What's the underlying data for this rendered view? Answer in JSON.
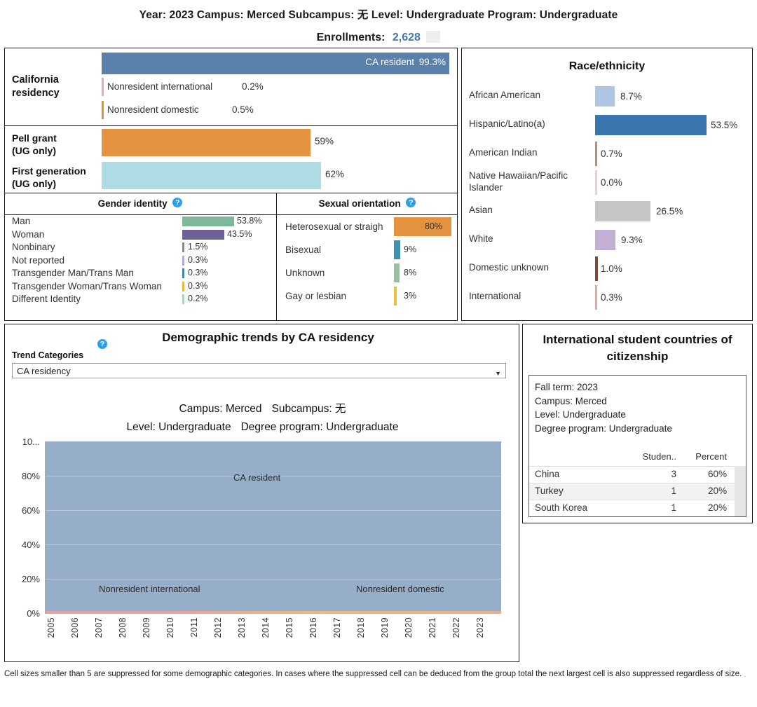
{
  "header": {
    "filters_line": "Year: 2023  Campus: Merced  Subcampus: 无  Level: Undergraduate  Program: Undergraduate",
    "enrollments_label": "Enrollments:",
    "enrollments_value": "2,628"
  },
  "residency": {
    "title": "California residency",
    "title_l1": "California",
    "title_l2": "residency",
    "items": [
      {
        "label": "CA resident",
        "value": "99.3%",
        "pct": 99.3,
        "color": "#5a81ac",
        "major": true
      },
      {
        "label": "Nonresident international",
        "value": "0.2%",
        "pct": 0.2,
        "color": "#eaa9aa",
        "major": false
      },
      {
        "label": "Nonresident domestic",
        "value": "0.5%",
        "pct": 0.5,
        "color": "#e8912f",
        "major": false
      }
    ]
  },
  "pell_firstgen": {
    "items": [
      {
        "label_l1": "Pell grant",
        "label_l2": "(UG only)",
        "value": "59%",
        "pct": 59,
        "color": "#e3933d"
      },
      {
        "label_l1": "First generation",
        "label_l2": "(UG only)",
        "value": "62%",
        "pct": 62,
        "color": "#aedce5"
      }
    ]
  },
  "gender_identity": {
    "title": "Gender identity",
    "help_icon": "help-circle-icon",
    "items": [
      {
        "label": "Man",
        "value": "53.8%",
        "pct": 53.8,
        "color": "#7db89a"
      },
      {
        "label": "Woman",
        "value": "43.5%",
        "pct": 43.5,
        "color": "#6d6196"
      },
      {
        "label": "Nonbinary",
        "value": "1.5%",
        "pct": 1.5,
        "color": "#8a8a8a"
      },
      {
        "label": "Not reported",
        "value": "0.3%",
        "pct": 0.3,
        "color": "#a8aedd"
      },
      {
        "label": "Transgender Man/Trans Man",
        "value": "0.3%",
        "pct": 0.3,
        "color": "#3f87a6"
      },
      {
        "label": "Transgender Woman/Trans Woman",
        "value": "0.3%",
        "pct": 0.3,
        "color": "#e8b63c"
      },
      {
        "label": "Different Identity",
        "value": "0.2%",
        "pct": 0.2,
        "color": "#a8d5b8"
      }
    ]
  },
  "sexual_orientation": {
    "title": "Sexual orientation",
    "help_icon": "help-circle-icon",
    "items": [
      {
        "label": "Heterosexual or straigh",
        "value": "80%",
        "pct": 80,
        "color": "#e3933d"
      },
      {
        "label": "Bisexual",
        "value": "9%",
        "pct": 9,
        "color": "#4190ac"
      },
      {
        "label": "Unknown",
        "value": "8%",
        "pct": 8,
        "color": "#9cbfa4"
      },
      {
        "label": "Gay or lesbian",
        "value": "3%",
        "pct": 3,
        "color": "#ecc33f"
      }
    ]
  },
  "race_ethnicity": {
    "title": "Race/ethnicity",
    "items": [
      {
        "label": "African American",
        "value": "8.7%",
        "pct": 8.7,
        "color": "#aec6e4",
        "wrap": false
      },
      {
        "label": "Hispanic/Latino(a)",
        "value": "53.5%",
        "pct": 53.5,
        "color": "#3a76ad",
        "wrap": false
      },
      {
        "label": "American Indian",
        "value": "0.7%",
        "pct": 0.7,
        "color": "#c08a7a",
        "wrap": false
      },
      {
        "label": "Native Hawaiian/Pacific Islander",
        "value": "0.0%",
        "pct": 0.0,
        "color": "#f3cdcd",
        "wrap": true
      },
      {
        "label": "Asian",
        "value": "26.5%",
        "pct": 26.5,
        "color": "#c6c6c6",
        "wrap": false
      },
      {
        "label": "White",
        "value": "9.3%",
        "pct": 9.3,
        "color": "#c3aed4",
        "wrap": false
      },
      {
        "label": "Domestic unknown",
        "value": "1.0%",
        "pct": 1.0,
        "color": "#7a4b3a",
        "wrap": false
      },
      {
        "label": "International",
        "value": "0.3%",
        "pct": 0.3,
        "color": "#e8a8a0",
        "wrap": false
      }
    ]
  },
  "trends": {
    "title": "Demographic trends by CA residency",
    "help_icon": "help-circle-icon",
    "trend_categories_label": "Trend Categories",
    "selected_category": "CA residency",
    "dropdown_options": [
      "CA residency"
    ],
    "dropdown_arrow": "chevron-down-icon",
    "subtitle_line1_a": "Campus: Merced",
    "subtitle_line1_b": "Subcampus: 无",
    "subtitle_line2_a": "Level: Undergraduate",
    "subtitle_line2_b": "Degree program: Undergraduate"
  },
  "chart_data": {
    "type": "area",
    "title": "Demographic trends by CA residency",
    "xlabel": "",
    "ylabel": "",
    "ylim": [
      0,
      100
    ],
    "grid": true,
    "ytick_labels": [
      "10...",
      "80%",
      "60%",
      "40%",
      "20%",
      "0%"
    ],
    "ytick_values": [
      100,
      80,
      60,
      40,
      20,
      0
    ],
    "x": [
      2005,
      2006,
      2007,
      2008,
      2009,
      2010,
      2011,
      2012,
      2013,
      2014,
      2015,
      2016,
      2017,
      2018,
      2019,
      2020,
      2021,
      2022,
      2023
    ],
    "annotations": [
      {
        "text": "CA resident",
        "x": 2013,
        "y": 50
      },
      {
        "text": "Nonresident international",
        "x": 2008,
        "y": 3
      },
      {
        "text": "Nonresident domestic",
        "x": 2019,
        "y": 3
      }
    ],
    "series": [
      {
        "name": "CA resident",
        "color": "#96aec8",
        "values": [
          99.0,
          99.1,
          99.0,
          98.8,
          98.7,
          98.6,
          98.5,
          98.4,
          98.3,
          98.4,
          98.6,
          98.8,
          99.0,
          99.1,
          99.2,
          99.3,
          99.3,
          99.3,
          99.3
        ]
      },
      {
        "name": "Nonresident international",
        "color": "#eaa9aa",
        "values": [
          0.3,
          0.3,
          0.3,
          0.4,
          0.5,
          0.6,
          0.7,
          0.8,
          0.9,
          0.8,
          0.7,
          0.6,
          0.5,
          0.4,
          0.4,
          0.3,
          0.3,
          0.2,
          0.2
        ]
      },
      {
        "name": "Nonresident domestic",
        "color": "#efb77a",
        "values": [
          0.7,
          0.6,
          0.7,
          0.8,
          0.8,
          0.8,
          0.8,
          0.8,
          0.8,
          0.8,
          0.7,
          0.6,
          0.5,
          0.5,
          0.4,
          0.4,
          0.4,
          0.5,
          0.5
        ]
      }
    ]
  },
  "international": {
    "title": "International student countries of citizenship",
    "meta": [
      "Fall term: 2023",
      "Campus: Merced",
      "Level: Undergraduate",
      "Degree program: Undergraduate"
    ],
    "columns": [
      "",
      "Studen..",
      "Percent"
    ],
    "rows": [
      {
        "country": "China",
        "students": "3",
        "percent": "60%"
      },
      {
        "country": "Turkey",
        "students": "1",
        "percent": "20%"
      },
      {
        "country": "South Korea",
        "students": "1",
        "percent": "20%"
      }
    ]
  },
  "footnote": {
    "text": "Cell sizes smaller than 5 are suppressed for some demographic categories. In cases where the suppressed cell can be deduced from the group total the next largest cell is also suppressed regardless of size."
  }
}
